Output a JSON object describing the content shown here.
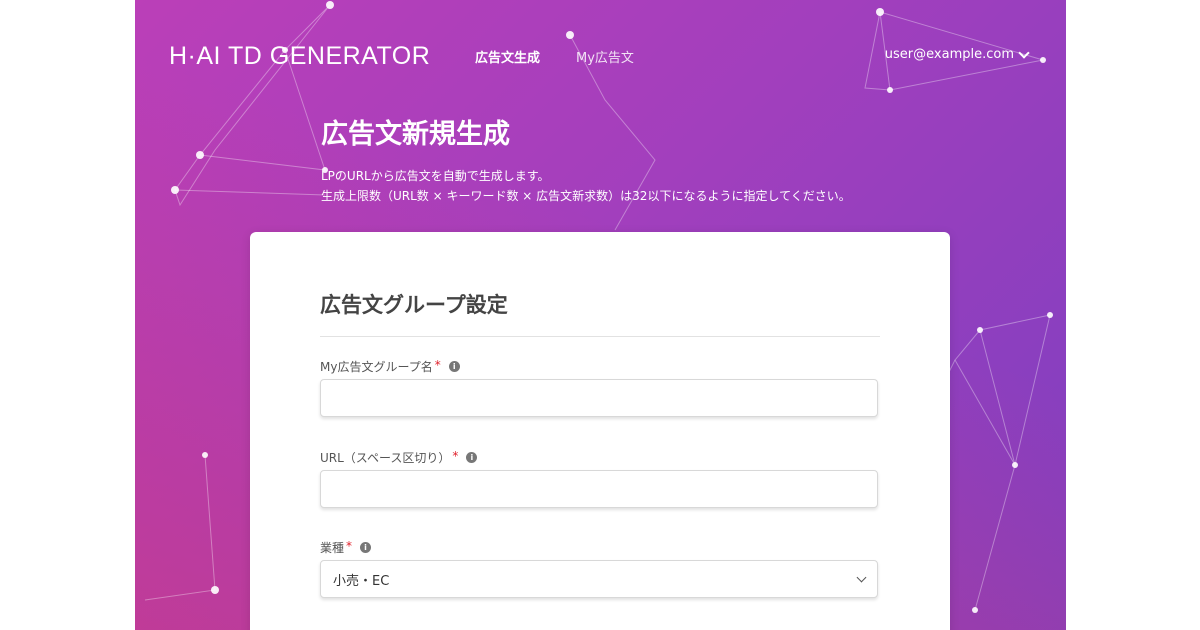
{
  "header": {
    "logo": "H·AI TD GENERATOR",
    "nav": [
      {
        "label": "広告文生成",
        "active": true
      },
      {
        "label": "My広告文",
        "active": false
      }
    ],
    "user_email": "user@example.com",
    "user_menu_icon": "chevron-down-icon"
  },
  "page": {
    "title": "広告文新規生成",
    "description_line1": "LPのURLから広告文を自動で生成します。",
    "description_line2": "生成上限数（URL数 × キーワード数 × 広告文新求数）は32以下になるように指定してください。"
  },
  "form": {
    "section_title": "広告文グループ設定",
    "required_mark": "*",
    "info_icon": "info-icon",
    "info_glyph": "i",
    "group_name": {
      "label": "My広告文グループ名",
      "value": "",
      "placeholder": ""
    },
    "url": {
      "label": "URL（スペース区切り）",
      "value": "",
      "placeholder": ""
    },
    "industry": {
      "label": "業種",
      "selected": "小売・EC",
      "icon": "chevron-down-icon"
    }
  },
  "colors": {
    "gradient_start": "#bb3fb8",
    "gradient_end": "#7e3fc0",
    "accent_pink": "#d6387a",
    "required_red": "#e0202a",
    "card_background": "#ffffff"
  }
}
